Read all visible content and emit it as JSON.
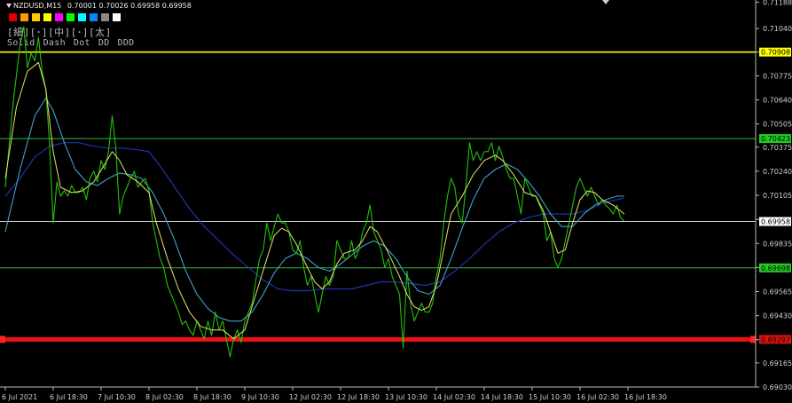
{
  "header": {
    "title": "NZDUSD,M15",
    "ohlc": "0.70001 0.70026 0.69958 0.69958"
  },
  "toolbar": {
    "swatch_colors": [
      "#e00000",
      "#ff9900",
      "#ffcc00",
      "#ffff00",
      "#ff00ff",
      "#00ff00",
      "#00ffff",
      "#0088ff",
      "#888888",
      "#ffffff"
    ],
    "width_buttons": [
      "[細]",
      "[･]",
      "[中]",
      "[･]",
      "[太]"
    ],
    "style_buttons": [
      "Solid",
      "Dash",
      "Dot",
      "DD",
      "DDD"
    ]
  },
  "colors": {
    "price": "#22c10a",
    "ma_fast": "#e8e46a",
    "ma_mid": "#3fa3c8",
    "ma_slow": "#2233aa",
    "yellow_line": "#ffff00",
    "green_line": "#3ab53a",
    "white_line": "#c8c8c8",
    "red_line": "#ee1111",
    "axis_text": "#d0d0d0"
  },
  "chart_data": {
    "type": "line",
    "symbol": "NZDUSD",
    "timeframe": "M15",
    "ylim": [
      0.6903,
      0.712
    ],
    "y_ticks": [
      0.71188,
      0.7104,
      0.70908,
      0.70775,
      0.7064,
      0.70505,
      0.70375,
      0.7024,
      0.70105,
      0.6997,
      0.69835,
      0.697,
      0.69565,
      0.6943,
      0.69295,
      0.69165,
      0.6903
    ],
    "y_tick_labels": [
      "0.71188",
      "0.71040",
      "",
      "0.70775",
      "0.70640",
      "0.70505",
      "0.70375",
      "0.70240",
      "0.70105",
      "",
      "0.69835",
      "",
      "0.69565",
      "0.69430",
      "",
      "0.69165",
      "0.69030"
    ],
    "x_tick_labels": [
      "6 Jul 2021",
      "6 Jul 18:30",
      "7 Jul 10:30",
      "8 Jul 02:30",
      "8 Jul 18:30",
      "9 Jul 10:30",
      "12 Jul 02:30",
      "12 Jul 18:30",
      "13 Jul 10:30",
      "14 Jul 02:30",
      "14 Jul 18:30",
      "15 Jul 10:30",
      "16 Jul 02:30",
      "16 Jul 18:30"
    ],
    "x_range": [
      0,
      169
    ],
    "x_ticks": [
      0,
      13,
      26,
      39,
      52,
      65,
      78,
      91,
      104,
      117,
      130,
      143,
      156,
      169
    ],
    "price_series": [
      [
        0,
        0.7015
      ],
      [
        2,
        0.706
      ],
      [
        4,
        0.7095
      ],
      [
        5,
        0.7105
      ],
      [
        6,
        0.7082
      ],
      [
        7,
        0.709
      ],
      [
        8,
        0.7086
      ],
      [
        9,
        0.7099
      ],
      [
        10,
        0.708
      ],
      [
        11,
        0.707
      ],
      [
        12,
        0.704
      ],
      [
        13,
        0.6995
      ],
      [
        14,
        0.7018
      ],
      [
        15,
        0.701
      ],
      [
        16,
        0.7013
      ],
      [
        17,
        0.701
      ],
      [
        18,
        0.7016
      ],
      [
        19,
        0.7012
      ],
      [
        20,
        0.7012
      ],
      [
        21,
        0.7015
      ],
      [
        22,
        0.7008
      ],
      [
        23,
        0.702
      ],
      [
        24,
        0.7024
      ],
      [
        25,
        0.7018
      ],
      [
        26,
        0.703
      ],
      [
        27,
        0.7025
      ],
      [
        28,
        0.7035
      ],
      [
        29,
        0.7055
      ],
      [
        30,
        0.7037
      ],
      [
        31,
        0.7
      ],
      [
        32,
        0.701
      ],
      [
        33,
        0.7015
      ],
      [
        34,
        0.702
      ],
      [
        35,
        0.7024
      ],
      [
        36,
        0.7015
      ],
      [
        37,
        0.7018
      ],
      [
        38,
        0.702
      ],
      [
        39,
        0.7013
      ],
      [
        40,
        0.6995
      ],
      [
        41,
        0.6985
      ],
      [
        42,
        0.6975
      ],
      [
        43,
        0.697
      ],
      [
        44,
        0.696
      ],
      [
        45,
        0.6955
      ],
      [
        46,
        0.695
      ],
      [
        47,
        0.6945
      ],
      [
        48,
        0.6938
      ],
      [
        49,
        0.694
      ],
      [
        50,
        0.6935
      ],
      [
        51,
        0.6932
      ],
      [
        52,
        0.694
      ],
      [
        53,
        0.6935
      ],
      [
        54,
        0.693
      ],
      [
        55,
        0.694
      ],
      [
        56,
        0.6932
      ],
      [
        57,
        0.6945
      ],
      [
        58,
        0.6935
      ],
      [
        59,
        0.694
      ],
      [
        60,
        0.693
      ],
      [
        61,
        0.692
      ],
      [
        62,
        0.693
      ],
      [
        63,
        0.6935
      ],
      [
        64,
        0.6928
      ],
      [
        65,
        0.694
      ],
      [
        66,
        0.6945
      ],
      [
        67,
        0.695
      ],
      [
        68,
        0.6963
      ],
      [
        69,
        0.6975
      ],
      [
        70,
        0.698
      ],
      [
        71,
        0.6995
      ],
      [
        72,
        0.6985
      ],
      [
        73,
        0.6993
      ],
      [
        74,
        0.7
      ],
      [
        75,
        0.6995
      ],
      [
        76,
        0.6995
      ],
      [
        77,
        0.699
      ],
      [
        78,
        0.698
      ],
      [
        79,
        0.6978
      ],
      [
        80,
        0.6985
      ],
      [
        81,
        0.697
      ],
      [
        82,
        0.696
      ],
      [
        83,
        0.6965
      ],
      [
        84,
        0.6955
      ],
      [
        85,
        0.6945
      ],
      [
        86,
        0.6955
      ],
      [
        87,
        0.6965
      ],
      [
        88,
        0.696
      ],
      [
        89,
        0.6965
      ],
      [
        90,
        0.6985
      ],
      [
        91,
        0.698
      ],
      [
        92,
        0.6975
      ],
      [
        93,
        0.6975
      ],
      [
        94,
        0.6985
      ],
      [
        95,
        0.6975
      ],
      [
        96,
        0.698
      ],
      [
        97,
        0.699
      ],
      [
        98,
        0.6995
      ],
      [
        99,
        0.7005
      ],
      [
        100,
        0.699
      ],
      [
        101,
        0.6985
      ],
      [
        102,
        0.698
      ],
      [
        103,
        0.697
      ],
      [
        104,
        0.6975
      ],
      [
        105,
        0.6965
      ],
      [
        106,
        0.696
      ],
      [
        107,
        0.6955
      ],
      [
        108,
        0.6925
      ],
      [
        109,
        0.6968
      ],
      [
        110,
        0.695
      ],
      [
        111,
        0.694
      ],
      [
        112,
        0.6945
      ],
      [
        113,
        0.695
      ],
      [
        114,
        0.6945
      ],
      [
        115,
        0.6945
      ],
      [
        116,
        0.695
      ],
      [
        117,
        0.6965
      ],
      [
        118,
        0.6975
      ],
      [
        119,
        0.6995
      ],
      [
        120,
        0.701
      ],
      [
        121,
        0.702
      ],
      [
        122,
        0.7015
      ],
      [
        123,
        0.7
      ],
      [
        124,
        0.6995
      ],
      [
        125,
        0.7015
      ],
      [
        126,
        0.704
      ],
      [
        127,
        0.703
      ],
      [
        128,
        0.7035
      ],
      [
        129,
        0.703
      ],
      [
        130,
        0.7035
      ],
      [
        131,
        0.7035
      ],
      [
        132,
        0.704
      ],
      [
        133,
        0.703
      ],
      [
        134,
        0.7038
      ],
      [
        135,
        0.7032
      ],
      [
        136,
        0.7025
      ],
      [
        137,
        0.702
      ],
      [
        138,
        0.702
      ],
      [
        139,
        0.701
      ],
      [
        140,
        0.7
      ],
      [
        141,
        0.702
      ],
      [
        142,
        0.7015
      ],
      [
        143,
        0.701
      ],
      [
        144,
        0.701
      ],
      [
        145,
        0.7005
      ],
      [
        146,
        0.7
      ],
      [
        147,
        0.6985
      ],
      [
        148,
        0.699
      ],
      [
        149,
        0.6975
      ],
      [
        150,
        0.697
      ],
      [
        151,
        0.6975
      ],
      [
        152,
        0.6985
      ],
      [
        153,
        0.6995
      ],
      [
        154,
        0.7005
      ],
      [
        155,
        0.7015
      ],
      [
        156,
        0.702
      ],
      [
        157,
        0.7015
      ],
      [
        158,
        0.701
      ],
      [
        159,
        0.7015
      ],
      [
        160,
        0.701
      ],
      [
        161,
        0.7005
      ],
      [
        162,
        0.7008
      ],
      [
        163,
        0.7005
      ],
      [
        164,
        0.7003
      ],
      [
        165,
        0.7
      ],
      [
        166,
        0.7005
      ],
      [
        167,
        0.6998
      ],
      [
        168,
        0.6996
      ]
    ],
    "ma_fast": [
      [
        0,
        0.702
      ],
      [
        3,
        0.706
      ],
      [
        6,
        0.708
      ],
      [
        9,
        0.7085
      ],
      [
        11,
        0.707
      ],
      [
        13,
        0.7035
      ],
      [
        15,
        0.7015
      ],
      [
        18,
        0.7012
      ],
      [
        21,
        0.7013
      ],
      [
        24,
        0.7018
      ],
      [
        27,
        0.7028
      ],
      [
        29,
        0.7035
      ],
      [
        31,
        0.703
      ],
      [
        33,
        0.7022
      ],
      [
        36,
        0.7018
      ],
      [
        39,
        0.7012
      ],
      [
        41,
        0.6995
      ],
      [
        44,
        0.6975
      ],
      [
        47,
        0.6958
      ],
      [
        50,
        0.6945
      ],
      [
        53,
        0.6937
      ],
      [
        56,
        0.6935
      ],
      [
        59,
        0.6935
      ],
      [
        62,
        0.693
      ],
      [
        65,
        0.6935
      ],
      [
        68,
        0.6955
      ],
      [
        71,
        0.6975
      ],
      [
        73,
        0.6988
      ],
      [
        75,
        0.6992
      ],
      [
        77,
        0.699
      ],
      [
        79,
        0.6983
      ],
      [
        82,
        0.697
      ],
      [
        84,
        0.6962
      ],
      [
        86,
        0.6958
      ],
      [
        88,
        0.6962
      ],
      [
        90,
        0.6972
      ],
      [
        92,
        0.6978
      ],
      [
        95,
        0.698
      ],
      [
        97,
        0.6985
      ],
      [
        99,
        0.6993
      ],
      [
        101,
        0.699
      ],
      [
        104,
        0.6978
      ],
      [
        107,
        0.6965
      ],
      [
        109,
        0.6955
      ],
      [
        111,
        0.6948
      ],
      [
        113,
        0.6946
      ],
      [
        115,
        0.6948
      ],
      [
        117,
        0.696
      ],
      [
        119,
        0.698
      ],
      [
        121,
        0.7
      ],
      [
        124,
        0.701
      ],
      [
        127,
        0.7022
      ],
      [
        130,
        0.703
      ],
      [
        133,
        0.7033
      ],
      [
        135,
        0.703
      ],
      [
        138,
        0.7022
      ],
      [
        141,
        0.7012
      ],
      [
        144,
        0.701
      ],
      [
        146,
        0.7002
      ],
      [
        148,
        0.699
      ],
      [
        150,
        0.6978
      ],
      [
        152,
        0.698
      ],
      [
        154,
        0.6995
      ],
      [
        156,
        0.7008
      ],
      [
        158,
        0.7013
      ],
      [
        160,
        0.7012
      ],
      [
        162,
        0.7008
      ],
      [
        165,
        0.7005
      ],
      [
        168,
        0.7
      ]
    ],
    "ma_mid": [
      [
        0,
        0.699
      ],
      [
        4,
        0.7025
      ],
      [
        8,
        0.7055
      ],
      [
        11,
        0.7065
      ],
      [
        13,
        0.7058
      ],
      [
        16,
        0.704
      ],
      [
        19,
        0.7025
      ],
      [
        22,
        0.7018
      ],
      [
        25,
        0.7016
      ],
      [
        28,
        0.702
      ],
      [
        31,
        0.7023
      ],
      [
        34,
        0.7022
      ],
      [
        37,
        0.702
      ],
      [
        40,
        0.7012
      ],
      [
        43,
        0.7
      ],
      [
        46,
        0.6985
      ],
      [
        49,
        0.6968
      ],
      [
        52,
        0.6955
      ],
      [
        55,
        0.6947
      ],
      [
        58,
        0.6942
      ],
      [
        61,
        0.694
      ],
      [
        64,
        0.694
      ],
      [
        67,
        0.6945
      ],
      [
        70,
        0.6955
      ],
      [
        73,
        0.6967
      ],
      [
        76,
        0.6975
      ],
      [
        79,
        0.6978
      ],
      [
        82,
        0.6975
      ],
      [
        85,
        0.697
      ],
      [
        88,
        0.6968
      ],
      [
        91,
        0.6972
      ],
      [
        94,
        0.6977
      ],
      [
        97,
        0.6982
      ],
      [
        100,
        0.6985
      ],
      [
        103,
        0.6982
      ],
      [
        106,
        0.6975
      ],
      [
        109,
        0.6965
      ],
      [
        112,
        0.6957
      ],
      [
        115,
        0.6955
      ],
      [
        118,
        0.696
      ],
      [
        121,
        0.6975
      ],
      [
        124,
        0.6992
      ],
      [
        127,
        0.7008
      ],
      [
        130,
        0.702
      ],
      [
        133,
        0.7025
      ],
      [
        136,
        0.7028
      ],
      [
        139,
        0.7025
      ],
      [
        142,
        0.7018
      ],
      [
        145,
        0.701
      ],
      [
        148,
        0.7
      ],
      [
        151,
        0.6993
      ],
      [
        154,
        0.6993
      ],
      [
        157,
        0.7
      ],
      [
        160,
        0.7005
      ],
      [
        163,
        0.7008
      ],
      [
        166,
        0.701
      ],
      [
        168,
        0.701
      ]
    ],
    "ma_slow": [
      [
        0,
        0.701
      ],
      [
        4,
        0.702
      ],
      [
        8,
        0.7032
      ],
      [
        12,
        0.7038
      ],
      [
        16,
        0.704
      ],
      [
        20,
        0.704
      ],
      [
        24,
        0.7038
      ],
      [
        28,
        0.7037
      ],
      [
        32,
        0.7037
      ],
      [
        36,
        0.7036
      ],
      [
        39,
        0.7035
      ],
      [
        42,
        0.7027
      ],
      [
        46,
        0.7015
      ],
      [
        50,
        0.7003
      ],
      [
        54,
        0.6993
      ],
      [
        58,
        0.6985
      ],
      [
        62,
        0.6977
      ],
      [
        66,
        0.697
      ],
      [
        70,
        0.6963
      ],
      [
        74,
        0.6958
      ],
      [
        78,
        0.6957
      ],
      [
        82,
        0.6957
      ],
      [
        86,
        0.6958
      ],
      [
        90,
        0.6958
      ],
      [
        94,
        0.6958
      ],
      [
        98,
        0.696
      ],
      [
        102,
        0.6962
      ],
      [
        106,
        0.6962
      ],
      [
        110,
        0.6961
      ],
      [
        114,
        0.696
      ],
      [
        118,
        0.6962
      ],
      [
        122,
        0.6968
      ],
      [
        126,
        0.6975
      ],
      [
        130,
        0.6983
      ],
      [
        134,
        0.699
      ],
      [
        138,
        0.6995
      ],
      [
        142,
        0.6998
      ],
      [
        146,
        0.7
      ],
      [
        150,
        0.7
      ],
      [
        154,
        0.7
      ],
      [
        158,
        0.7002
      ],
      [
        162,
        0.7006
      ],
      [
        166,
        0.7008
      ],
      [
        168,
        0.7009
      ]
    ],
    "hlines": [
      {
        "price": 0.70908,
        "label": "0.70908",
        "style": "yellow"
      },
      {
        "price": 0.70423,
        "label": "0.70423",
        "style": "green"
      },
      {
        "price": 0.69958,
        "label": "0.69958",
        "style": "white"
      },
      {
        "price": 0.69698,
        "label": "0.69698",
        "style": "green"
      },
      {
        "price": 0.69297,
        "label": "0.69297",
        "style": "red"
      }
    ]
  }
}
